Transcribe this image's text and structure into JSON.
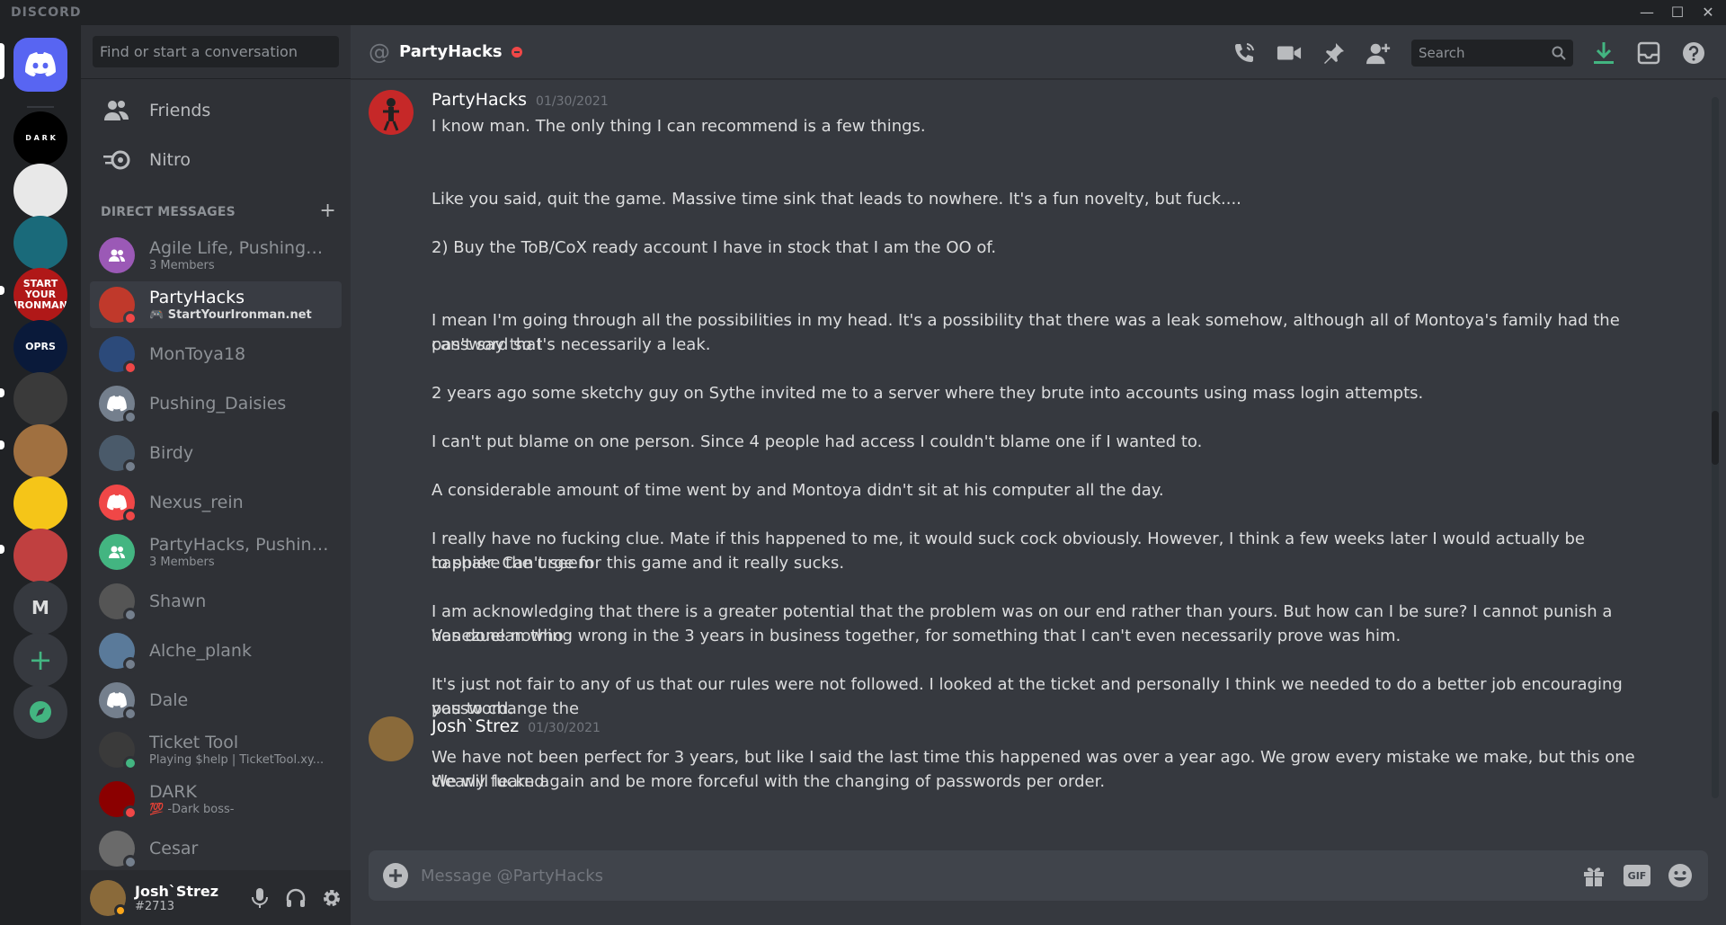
{
  "app": {
    "brand": "DISCORD"
  },
  "window_controls": {
    "minimize": "—",
    "maximize": "☐",
    "close": "✕"
  },
  "servers": [
    {
      "id": "home",
      "label": "",
      "icon": "discord-logo-icon",
      "color": "#5865f2"
    },
    {
      "id": "dark",
      "label": "D A R K",
      "color": "#000000"
    },
    {
      "id": "ghost",
      "label": "",
      "color": "#e8e8e8"
    },
    {
      "id": "swirl",
      "label": "",
      "color": "#1a6a7a"
    },
    {
      "id": "ironman",
      "label": "START YOUR IRONMAN",
      "color": "#b01818"
    },
    {
      "id": "oprs",
      "label": "OPRS",
      "color": "#0a1a3a"
    },
    {
      "id": "dog",
      "label": "",
      "color": "#3a3a3a"
    },
    {
      "id": "goku",
      "label": "",
      "color": "#a07040"
    },
    {
      "id": "pancake",
      "label": "",
      "color": "#f5c518"
    },
    {
      "id": "red",
      "label": "",
      "color": "#c04040"
    },
    {
      "id": "m",
      "label": "M",
      "color": "#36393f"
    }
  ],
  "server_actions": {
    "add_label": "+",
    "explore_label": ""
  },
  "dm_sidebar": {
    "search_placeholder": "Find or start a conversation",
    "friends_label": "Friends",
    "nitro_label": "Nitro",
    "direct_messages_header": "DIRECT MESSAGES",
    "add_dm": "+",
    "items": [
      {
        "name": "Agile Life, Pushing_D...",
        "sub": "3 Members",
        "color": "#9b59b6",
        "status": "",
        "group": true
      },
      {
        "name": "PartyHacks",
        "sub": "🎮 StartYourIronman.net",
        "color": "#c0392b",
        "status": "dnd",
        "active": true
      },
      {
        "name": "MonToya18",
        "sub": "",
        "color": "#2c4a7a",
        "status": "dnd"
      },
      {
        "name": "Pushing_Daisies",
        "sub": "",
        "color": "#747f8d",
        "status": "off"
      },
      {
        "name": "Birdy",
        "sub": "",
        "color": "#4a5a6a",
        "status": "off"
      },
      {
        "name": "Nexus_rein",
        "sub": "",
        "color": "#f04747",
        "status": "dnd"
      },
      {
        "name": "PartyHacks, Pushing_...",
        "sub": "3 Members",
        "color": "#43b581",
        "status": "",
        "group": true
      },
      {
        "name": "Shawn",
        "sub": "",
        "color": "#555555",
        "status": "off"
      },
      {
        "name": "Alche_plank",
        "sub": "",
        "color": "#5a7a9a",
        "status": "off"
      },
      {
        "name": "Dale",
        "sub": "",
        "color": "#747f8d",
        "status": "off"
      },
      {
        "name": "Ticket Tool",
        "sub": "Playing $help | TicketTool.xy...",
        "color": "#3a3a3a",
        "status": "on"
      },
      {
        "name": "DARK",
        "sub": "💯 -Dark boss-",
        "color": "#8b0000",
        "status": "dnd"
      },
      {
        "name": "Cesar",
        "sub": "",
        "color": "#6a6a6a",
        "status": "off"
      }
    ]
  },
  "user_panel": {
    "name": "Josh`Strez",
    "tag": "#2713",
    "status": "idle"
  },
  "channel": {
    "at": "@",
    "title": "PartyHacks",
    "search_placeholder": "Search"
  },
  "messages": [
    {
      "author": "PartyHacks",
      "time": "01/30/2021",
      "lines": [
        "I know man. The only thing I can recommend is a few things.",
        "",
        "",
        "Like you said, quit the game. Massive time sink that leads to nowhere. It's a fun novelty, but fuck....",
        "",
        "2) Buy the ToB/CoX ready account I have in stock that I am the OO of.",
        "",
        "",
        "I mean I'm going through all the possibilities in my head. It's a possibility that there was a leak somehow, although all of Montoya's family had the password so I",
        "can't say that's necessarily a leak.",
        "",
        "2 years ago some sketchy guy on Sythe invited me to a server where they brute into accounts using mass login attempts.",
        "",
        "I can't put blame on one person. Since 4 people had access I couldn't blame one if I wanted to.",
        "",
        " A considerable amount of time went by and Montoya didn't sit at his computer all the day.",
        "",
        "I really have no fucking clue. Mate if this happened to me, it would suck cock obviously. However, I think a few weeks later I would actually be happier. Can't seem",
        "to shake the urge for this game and it really sucks.",
        "",
        "I am acknowledging that there is a greater potential that the problem was on our end rather than yours. But how can I be sure? I cannot punish a Venezuelan who",
        "has done nothing wrong in the 3 years in business together, for something that I can't even necessarily prove was him.",
        "",
        "It's just not fair to any of us that our rules were not followed. I looked at the ticket and personally I think we needed to do a better job encouraging you to change the",
        "password.",
        "",
        "We have not been perfect for 3 years, but like I said the last time this happened was over a year ago.  We grow every mistake we make, but this one clearly fucked.",
        "We will learn again and be more forceful with the changing of passwords per order."
      ]
    },
    {
      "author": "Josh`Strez",
      "time": "01/30/2021",
      "lines": []
    }
  ],
  "composer": {
    "placeholder": "Message @PartyHacks",
    "gif_label": "GIF"
  },
  "colors": {
    "accent": "#5865f2",
    "dnd": "#f04747",
    "online": "#43b581",
    "download": "#43b581"
  }
}
